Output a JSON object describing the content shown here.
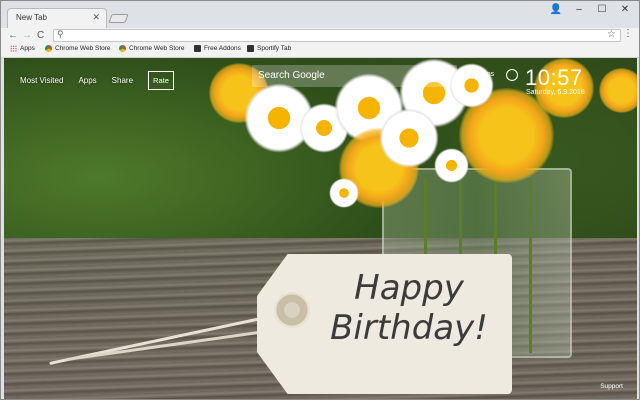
{
  "browser": {
    "tab_title": "New Tab",
    "tab_close": "✕",
    "window_controls": {
      "profile": "👤",
      "minimize": "–",
      "maximize": "☐",
      "close": "✕"
    },
    "nav": {
      "back": "←",
      "forward": "→",
      "reload": "C"
    },
    "omnibox": {
      "value": "",
      "search_glyph": "🔍",
      "star": "☆",
      "menu": "⋮"
    },
    "bookmarks": [
      {
        "label": "Apps",
        "icon": "apps-grid-icon"
      },
      {
        "label": "Chrome Web Store",
        "icon": "chrome-store-icon"
      },
      {
        "label": "Chrome Web Store",
        "icon": "chrome-store-icon"
      },
      {
        "label": "Free Addons",
        "icon": "bookmark-icon"
      },
      {
        "label": "Sportify Tab",
        "icon": "bookmark-icon"
      }
    ]
  },
  "newtab": {
    "nav_links": [
      "Most Visited",
      "Apps",
      "Share"
    ],
    "rate_label": "Rate",
    "search_placeholder": "Search Google",
    "options_label": "Options",
    "time": "10:57",
    "date": "Saturday, 6.9.2018",
    "support_label": "Support",
    "tag_text_line1": "Happy",
    "tag_text_line2": "Birthday!"
  },
  "colors": {
    "tab_bg": "#f2f2f2",
    "strip_bg": "#dee1e6",
    "overlay_text": "#ffffff"
  }
}
